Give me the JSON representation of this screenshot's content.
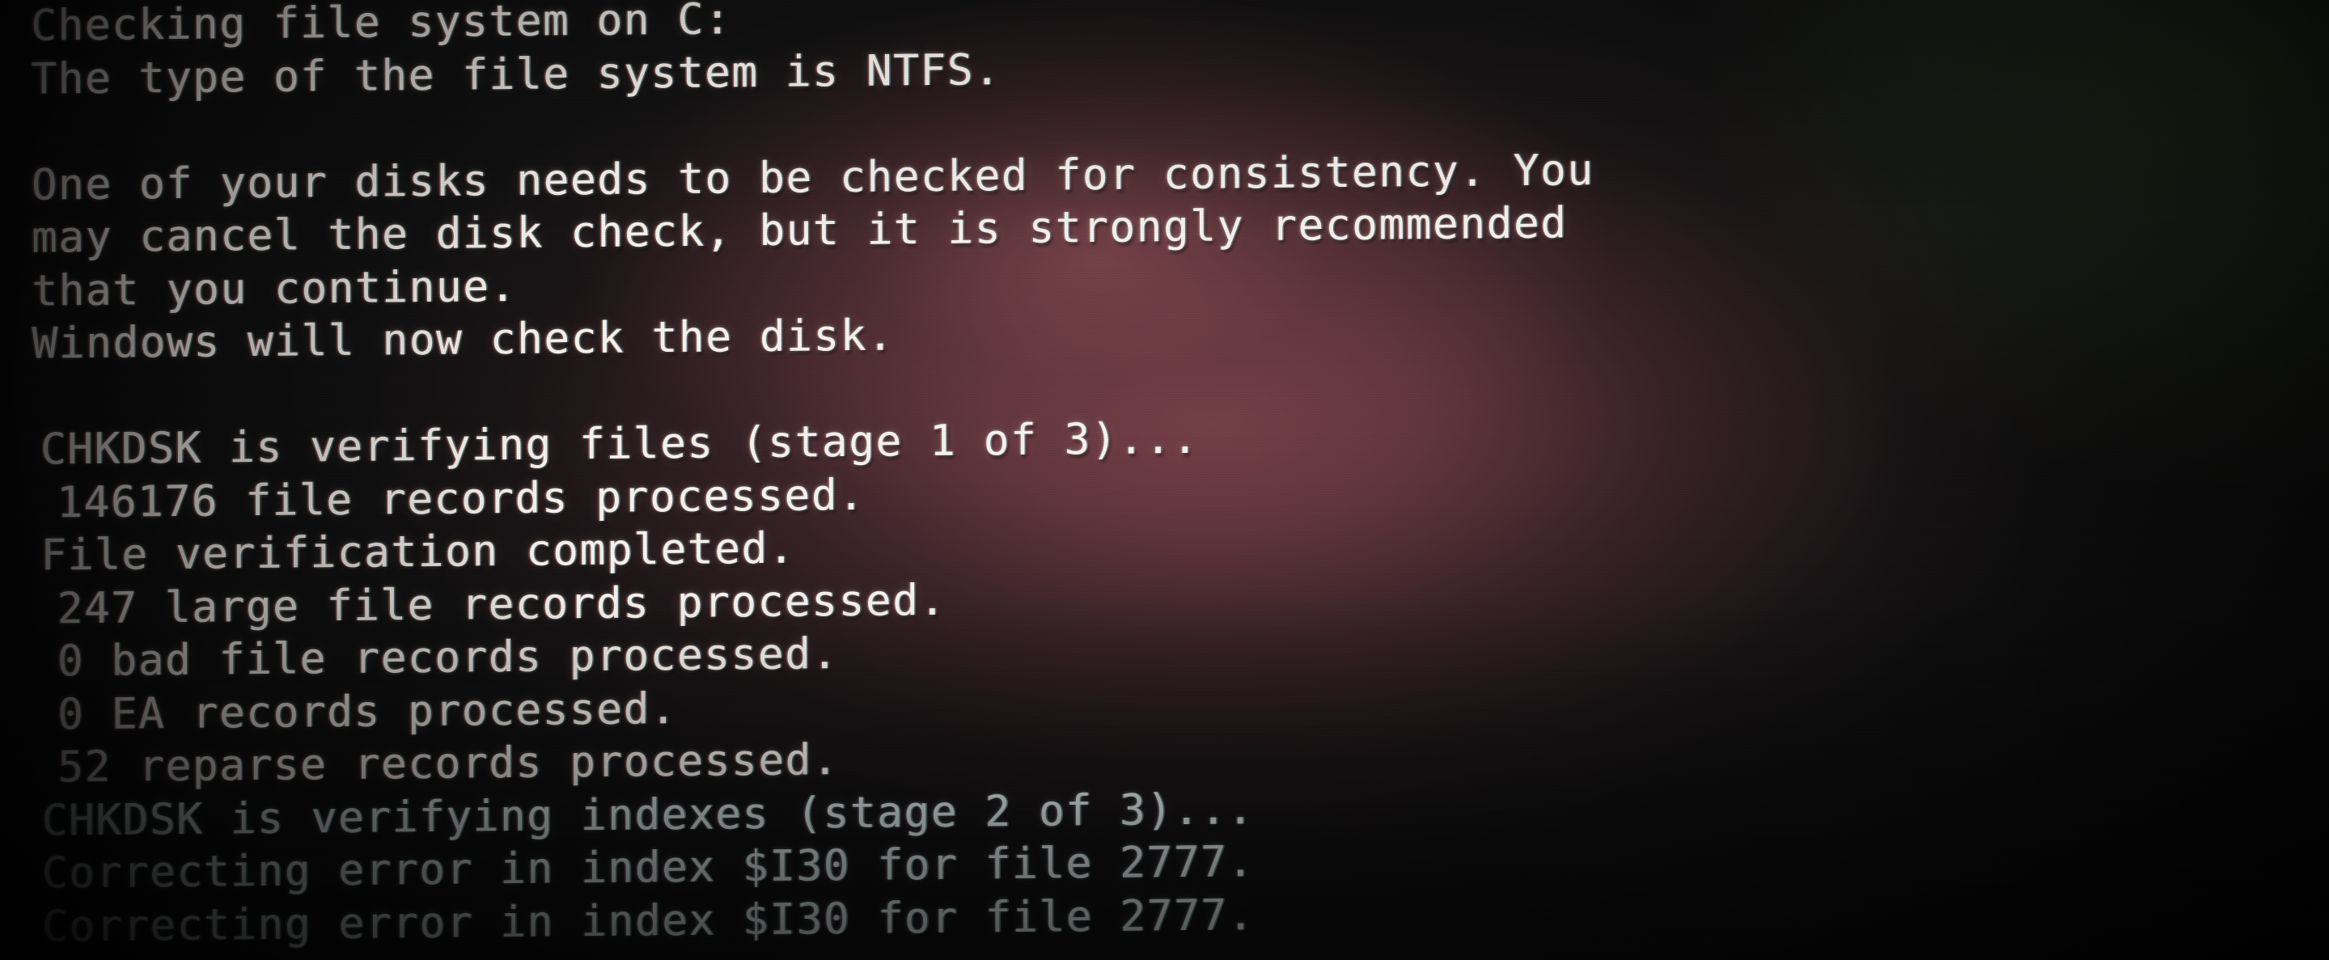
{
  "screen": {
    "title": "Windows CHKDSK boot-time disk check",
    "background_dark": "#141414",
    "background_glow": "#52333a",
    "background_green": "#252a20",
    "text_color": "#f4f2ef",
    "text_color_cool": "#e2eceb"
  },
  "console": {
    "lines": [
      {
        "text": "Checking file system on C:",
        "indent": 0,
        "tint": "warm"
      },
      {
        "text": "The type of the file system is NTFS.",
        "indent": 0,
        "tint": "warm"
      },
      {
        "text": "",
        "indent": 0,
        "tint": "warm"
      },
      {
        "text": "One of your disks needs to be checked for consistency. You",
        "indent": 0,
        "tint": "warm"
      },
      {
        "text": "may cancel the disk check, but it is strongly recommended",
        "indent": 0,
        "tint": "warm"
      },
      {
        "text": "that you continue.",
        "indent": 0,
        "tint": "warm"
      },
      {
        "text": "Windows will now check the disk.",
        "indent": 0,
        "tint": "warm"
      },
      {
        "text": "",
        "indent": 0,
        "tint": "warm"
      },
      {
        "text": "CHKDSK is verifying files (stage 1 of 3)...",
        "indent": 1,
        "tint": "warm"
      },
      {
        "text": "146176 file records processed.",
        "indent": 3,
        "tint": "warm"
      },
      {
        "text": "File verification completed.",
        "indent": 1,
        "tint": "warm"
      },
      {
        "text": "247 large file records processed.",
        "indent": 3,
        "tint": "warm"
      },
      {
        "text": "0 bad file records processed.",
        "indent": 3,
        "tint": "warm"
      },
      {
        "text": "0 EA records processed.",
        "indent": 3,
        "tint": "warm"
      },
      {
        "text": "52 reparse records processed.",
        "indent": 3,
        "tint": "warm"
      },
      {
        "text": "CHKDSK is verifying indexes (stage 2 of 3)...",
        "indent": 1,
        "tint": "cool"
      },
      {
        "text": "Correcting error in index $I30 for file 2777.",
        "indent": 1,
        "tint": "cool"
      },
      {
        "text": "Correcting error in index $I30 for file 2777.",
        "indent": 1,
        "tint": "cool"
      }
    ],
    "volume": "C:",
    "filesystem": "NTFS",
    "stage_current": 2,
    "stage_total": 3,
    "counts": {
      "file_records_processed": 146176,
      "large_file_records_processed": 247,
      "bad_file_records_processed": 0,
      "ea_records_processed": 0,
      "reparse_records_processed": 52
    },
    "error": {
      "index": "$I30",
      "file": 2777,
      "occurrences": 2
    }
  }
}
